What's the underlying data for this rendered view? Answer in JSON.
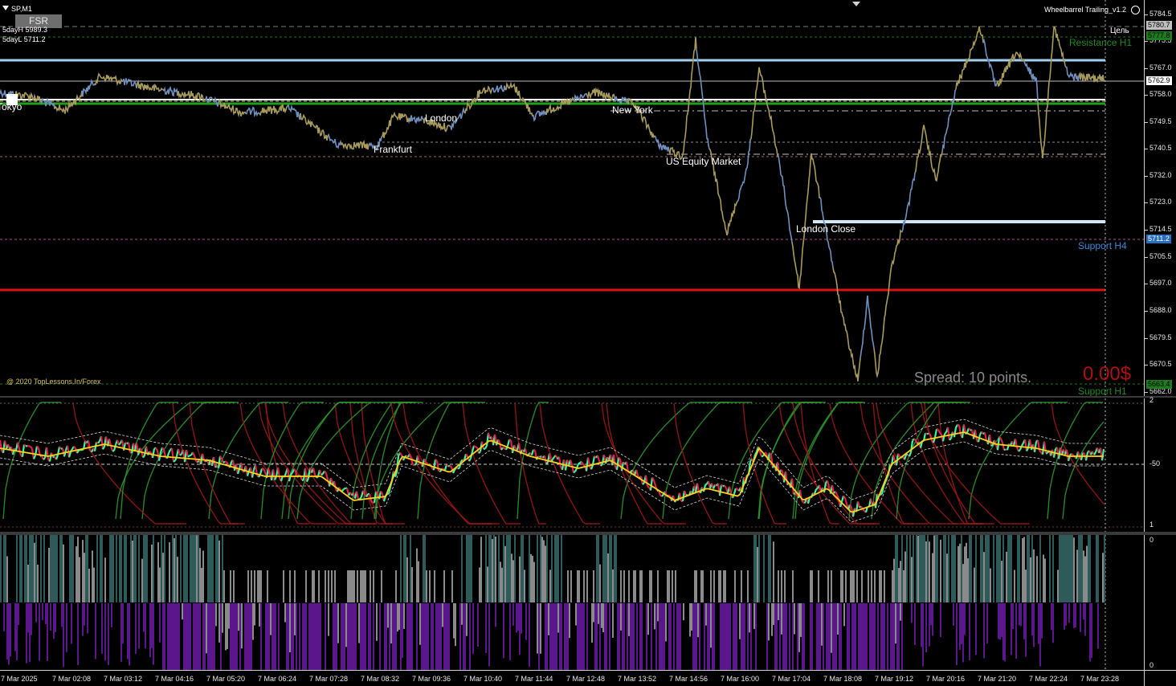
{
  "window": {
    "symbol_label": "SP,M1",
    "indicator_title": "Wheelbarrel Trailing_v1.2",
    "fsr_button": "FSR",
    "five_day_high": "5dayH 5989.3",
    "five_day_low": "5dayL 5711.2",
    "copyright": "@ 2020 TopLessons.In/Forex"
  },
  "sessions": {
    "tokyo": "Tokyo",
    "london": "London",
    "frankfurt": "Frankfurt",
    "new_york": "New York",
    "us_equity": "US Equity Market",
    "london_close": "London Close"
  },
  "levels": {
    "target": "Цель",
    "resistance": "Resistance H1",
    "support_h4": "Support H4",
    "support_h1": "Support H1"
  },
  "info": {
    "spread": "Spread: 10 points.",
    "profit": "0.00$"
  },
  "price_axis": {
    "ticks": [
      "5784.5",
      "5775.5",
      "5767.0",
      "5758.0",
      "5749.5",
      "5740.5",
      "5732.0",
      "5723.0",
      "5714.5",
      "5705.5",
      "5697.0",
      "5688.0",
      "5679.5",
      "5670.5",
      "5662.0"
    ],
    "boxes": [
      {
        "text": "5780.7",
        "bg": "#c0c0c0",
        "color": "#000000"
      },
      {
        "text": "5777.8",
        "bg": "#1e7a1e",
        "color": "#000000"
      },
      {
        "text": "5762.9",
        "bg": "#ffffff",
        "color": "#000000"
      },
      {
        "text": "5711.2",
        "bg": "#2a6fbf",
        "color": "#ffffff"
      },
      {
        "text": "5663.4",
        "bg": "#1e7a1e",
        "color": "#000000"
      }
    ]
  },
  "osc_axis": {
    "ticks": [
      "2",
      "-50",
      "1"
    ]
  },
  "hist_axis": {
    "ticks": [
      "0",
      "0"
    ]
  },
  "time_axis": {
    "labels": [
      "7 Mar 2025",
      "7 Mar 02:08",
      "7 Mar 03:12",
      "7 Mar 04:16",
      "7 Mar 05:20",
      "7 Mar 06:24",
      "7 Mar 07:28",
      "7 Mar 08:32",
      "7 Mar 09:36",
      "7 Mar 10:40",
      "7 Mar 11:44",
      "7 Mar 12:48",
      "7 Mar 13:52",
      "7 Mar 14:56",
      "7 Mar 16:00",
      "7 Mar 17:04",
      "7 Mar 18:08",
      "7 Mar 19:12",
      "7 Mar 20:16",
      "7 Mar 21:20",
      "7 Mar 22:24",
      "7 Mar 23:28"
    ]
  },
  "colors": {
    "background": "#000000",
    "price_line": "#a89a5a",
    "price_line_alt": "#6f8fbf",
    "resistance_line": "#9fd0ee",
    "green_level": "#1ea01e",
    "red_level": "#e01010",
    "spread_text": "#8a8a8a",
    "profit_text": "#b01010",
    "osc_green": "#2e9b2e",
    "osc_red": "#a01818",
    "osc_fast": "#3ff59a",
    "osc_slow": "#ffd21a",
    "hist_teal": "#2f5a5a",
    "hist_purple": "#5b168c",
    "hist_grey": "#8a8a8a"
  }
}
